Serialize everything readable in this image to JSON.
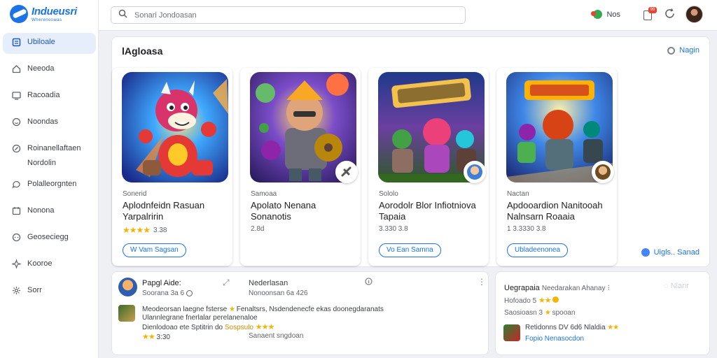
{
  "app": {
    "name": "Indueusri",
    "tagline": "Wherenoswas"
  },
  "header": {
    "search_placeholder": "Sonari Jondoasan",
    "status_label": "Nos",
    "notification_count": "99"
  },
  "sidebar": {
    "items": [
      {
        "label": "Ubiloale",
        "icon": "box-icon"
      },
      {
        "label": "Neeoda",
        "icon": "home-icon"
      },
      {
        "label": "Racoadia",
        "icon": "monitor-icon"
      },
      {
        "label": "Noondas",
        "icon": "smile-icon"
      },
      {
        "label": "Roinanellaftaen Nordolin",
        "icon": "pencil-icon"
      },
      {
        "label": "Polalleorgnten",
        "icon": "chat-icon"
      },
      {
        "label": "Nonona",
        "icon": "calendar-icon"
      },
      {
        "label": "Geoseciegg",
        "icon": "chat-bubble-icon"
      },
      {
        "label": "Kooroe",
        "icon": "sparkle-icon"
      },
      {
        "label": "Sorr",
        "icon": "gear-icon"
      }
    ]
  },
  "featured": {
    "title": "lAgloasa",
    "more_label": "Nagin",
    "side_action_label": "Uigls.. Sanad",
    "cards": [
      {
        "category": "Sonerid",
        "title": "Aplodnfeidn Rasuan Yarpalririn",
        "rating": "3.38",
        "action": "W Vam Sagsan"
      },
      {
        "category": "Samoaa",
        "title": "Apolato Nenana Sonanotis",
        "rating": "2.8d",
        "action": ""
      },
      {
        "category": "Sololo",
        "title": "Aorodolr Blor Infiotniova Tapaia",
        "rating": "3.330 3.8",
        "action": "Vo Ean Samna"
      },
      {
        "category": "Nactan",
        "title": "Apdooardion Nanitooah Nalnsarn Roaaia",
        "rating": "1 3.3330 3.8",
        "action": "Ubladeenonea"
      }
    ]
  },
  "reviews": {
    "left": {
      "name": "Papgl Aide:",
      "subtitle": "Soorana 3a 6",
      "meta_title": "Nederlasan",
      "meta_sub": "Nonoonsan 6a 426",
      "line1": "Meodeorsan laegne fsterse",
      "line1_after": "Fenaltsrs, Nsdendenecfe ekas doonegdaranats",
      "line2": "Ulannlegrane fnerlalar perelanenaloe",
      "line3": "Dienlodoao ete Sptitrin do",
      "line3_after": "Sospsulo",
      "rating_small": "3:30",
      "foot": "Sanaent sngdoan"
    },
    "right": {
      "name": "Uegrapaia",
      "name_after": "Needarakan Ahanay",
      "sub": "Hofoado 5",
      "meta_line": "Saosioasn 3",
      "meta_after": "spooan",
      "line1": "Retidonns DV 6d6 Nlaldia",
      "line2": "Fopio Nenasocdon"
    }
  },
  "colors": {
    "accent": "#1a73e8",
    "star": "#f4b400",
    "badge": "#ea4335"
  }
}
